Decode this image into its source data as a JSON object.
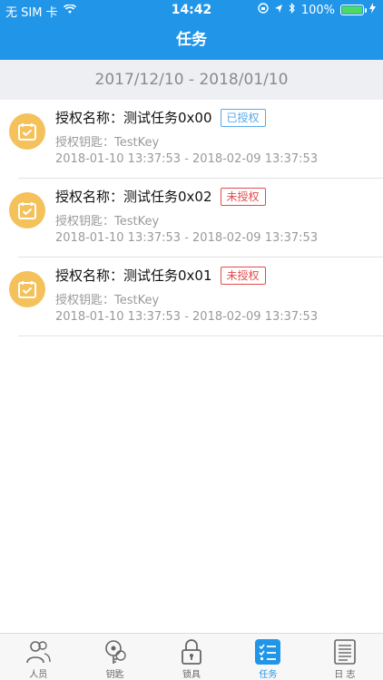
{
  "status": {
    "carrier": "无 SIM 卡",
    "time": "14:42",
    "battery_pct": "100%",
    "battery_level": 1.0
  },
  "nav": {
    "title": "任务"
  },
  "date_range": "2017/12/10 - 2018/01/10",
  "tasks": [
    {
      "title": "授权名称：测试任务0x00",
      "status_label": "已授权",
      "status": "authorized",
      "key_line": "授权钥匙：TestKey",
      "time_range": "2018-01-10 13:37:53 - 2018-02-09 13:37:53"
    },
    {
      "title": "授权名称：测试任务0x02",
      "status_label": "未授权",
      "status": "unauthorized",
      "key_line": "授权钥匙：TestKey",
      "time_range": "2018-01-10 13:37:53 - 2018-02-09 13:37:53"
    },
    {
      "title": "授权名称：测试任务0x01",
      "status_label": "未授权",
      "status": "unauthorized",
      "key_line": "授权钥匙：TestKey",
      "time_range": "2018-01-10 13:37:53 - 2018-02-09 13:37:53"
    }
  ],
  "tabs": [
    {
      "label": "人员",
      "icon": "people-icon",
      "active": false
    },
    {
      "label": "钥匙",
      "icon": "key-icon",
      "active": false
    },
    {
      "label": "锁具",
      "icon": "lock-icon",
      "active": false
    },
    {
      "label": "任务",
      "icon": "task-list-icon",
      "active": true
    },
    {
      "label": "日 志",
      "icon": "log-document-icon",
      "active": false
    }
  ],
  "colors": {
    "primary": "#2196e9",
    "task_icon_bg": "#f4c15b",
    "authorized": "#5aa9e6",
    "unauthorized": "#e34b4b"
  }
}
